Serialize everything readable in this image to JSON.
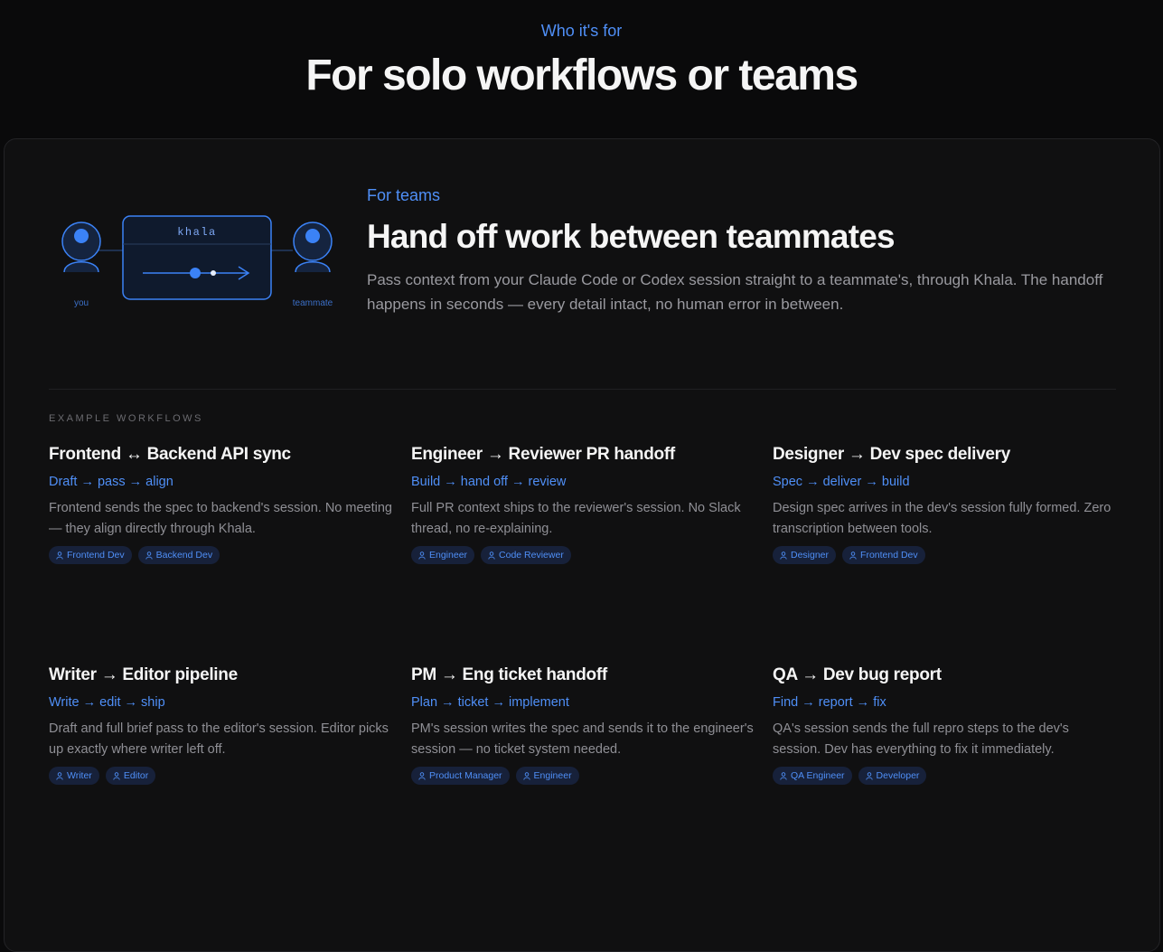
{
  "section": {
    "eyebrow": "Who it's for",
    "title": "For solo workflows or teams"
  },
  "hero": {
    "eyebrow": "For teams",
    "title": "Hand off work between teammates",
    "description": "Pass context from your Claude Code or Codex session straight to a teammate's, through Khala. The handoff happens in seconds — every detail intact, no human error in between.",
    "illustration": {
      "box_label": "khala",
      "left_label": "you",
      "right_label": "teammate"
    }
  },
  "examples_label": "EXAMPLE WORKFLOWS",
  "workflows": [
    {
      "title": "Frontend ↔ Backend API sync",
      "steps": "Draft → pass → align",
      "description": "Frontend sends the spec to backend's session. No meeting — they align directly through Khala.",
      "tags": [
        "Frontend Dev",
        "Backend Dev"
      ]
    },
    {
      "title": "Engineer → Reviewer PR handoff",
      "steps": "Build → hand off → review",
      "description": "Full PR context ships to the reviewer's session. No Slack thread, no re-explaining.",
      "tags": [
        "Engineer",
        "Code Reviewer"
      ]
    },
    {
      "title": "Designer → Dev spec delivery",
      "steps": "Spec → deliver → build",
      "description": "Design spec arrives in the dev's session fully formed. Zero transcription between tools.",
      "tags": [
        "Designer",
        "Frontend Dev"
      ]
    },
    {
      "title": "Writer → Editor pipeline",
      "steps": "Write → edit → ship",
      "description": "Draft and full brief pass to the editor's session. Editor picks up exactly where writer left off.",
      "tags": [
        "Writer",
        "Editor"
      ]
    },
    {
      "title": "PM → Eng ticket handoff",
      "steps": "Plan → ticket → implement",
      "description": "PM's session writes the spec and sends it to the engineer's session — no ticket system needed.",
      "tags": [
        "Product Manager",
        "Engineer"
      ]
    },
    {
      "title": "QA → Dev bug report",
      "steps": "Find → report → fix",
      "description": "QA's session sends the full repro steps to the dev's session. Dev has everything to fix it immediately.",
      "tags": [
        "QA Engineer",
        "Developer"
      ]
    }
  ],
  "colors": {
    "accent": "#4f8ff7",
    "background": "#0a0a0b",
    "card": "#101011",
    "tag_bg": "#17213a"
  }
}
